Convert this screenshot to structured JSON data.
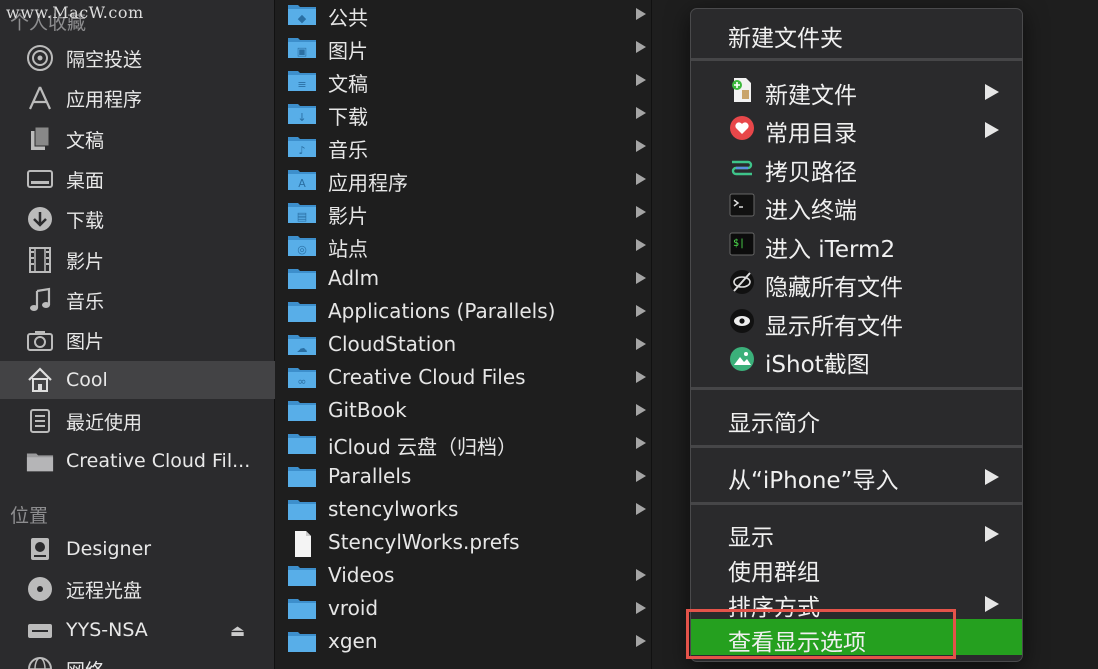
{
  "watermark": "www.MacW.com",
  "sidebar": {
    "favorites_heading": "个人收藏",
    "favorites": [
      {
        "label": "隔空投送",
        "icon": "airdrop-icon"
      },
      {
        "label": "应用程序",
        "icon": "applications-icon"
      },
      {
        "label": "文稿",
        "icon": "documents-icon"
      },
      {
        "label": "桌面",
        "icon": "desktop-icon"
      },
      {
        "label": "下载",
        "icon": "downloads-icon"
      },
      {
        "label": "影片",
        "icon": "movies-icon"
      },
      {
        "label": "音乐",
        "icon": "music-icon"
      },
      {
        "label": "图片",
        "icon": "pictures-icon"
      },
      {
        "label": "Cool",
        "icon": "home-icon",
        "selected": true
      },
      {
        "label": "最近使用",
        "icon": "recents-icon"
      },
      {
        "label": "Creative Cloud Fil...",
        "icon": "folder-icon"
      }
    ],
    "locations_heading": "位置",
    "locations": [
      {
        "label": "Designer",
        "icon": "hard-drive-icon"
      },
      {
        "label": "远程光盘",
        "icon": "optical-disc-icon"
      },
      {
        "label": "YYS-NSA",
        "icon": "network-drive-icon",
        "eject": "⏏"
      },
      {
        "label": "网络",
        "icon": "network-icon"
      }
    ]
  },
  "column": {
    "items": [
      {
        "label": "公共",
        "icon": "public-folder-icon",
        "arrow": true
      },
      {
        "label": "图片",
        "icon": "pictures-folder-icon",
        "arrow": true
      },
      {
        "label": "文稿",
        "icon": "documents-folder-icon",
        "arrow": true
      },
      {
        "label": "下载",
        "icon": "downloads-folder-icon",
        "arrow": true
      },
      {
        "label": "音乐",
        "icon": "music-folder-icon",
        "arrow": true
      },
      {
        "label": "应用程序",
        "icon": "applications-folder-icon",
        "arrow": true
      },
      {
        "label": "影片",
        "icon": "movies-folder-icon",
        "arrow": true
      },
      {
        "label": "站点",
        "icon": "sites-folder-icon",
        "arrow": true
      },
      {
        "label": "Adlm",
        "icon": "folder-icon",
        "arrow": true
      },
      {
        "label": "Applications (Parallels)",
        "icon": "folder-icon",
        "arrow": true
      },
      {
        "label": "CloudStation",
        "icon": "cloud-folder-icon",
        "arrow": true
      },
      {
        "label": "Creative Cloud Files",
        "icon": "creative-cloud-folder-icon",
        "arrow": true
      },
      {
        "label": "GitBook",
        "icon": "folder-icon",
        "arrow": true
      },
      {
        "label": "iCloud 云盘（归档）",
        "icon": "folder-icon",
        "arrow": true
      },
      {
        "label": "Parallels",
        "icon": "folder-icon",
        "arrow": true
      },
      {
        "label": "stencylworks",
        "icon": "folder-icon",
        "arrow": true
      },
      {
        "label": "StencylWorks.prefs",
        "icon": "document-icon",
        "arrow": false
      },
      {
        "label": "Videos",
        "icon": "folder-icon",
        "arrow": true
      },
      {
        "label": "vroid",
        "icon": "folder-icon",
        "arrow": true
      },
      {
        "label": "xgen",
        "icon": "folder-icon",
        "arrow": true
      }
    ]
  },
  "menu": {
    "new_folder": "新建文件夹",
    "group2": [
      {
        "label": "新建文件",
        "icon": "new-file-icon",
        "submenu": true
      },
      {
        "label": "常用目录",
        "icon": "heart-icon",
        "submenu": true
      },
      {
        "label": "拷贝路径",
        "icon": "copy-path-icon",
        "submenu": false
      },
      {
        "label": "进入终端",
        "icon": "terminal-icon",
        "submenu": false
      },
      {
        "label": "进入 iTerm2",
        "icon": "iterm-icon",
        "submenu": false
      },
      {
        "label": "隐藏所有文件",
        "icon": "eye-slash-icon",
        "submenu": false
      },
      {
        "label": "显示所有文件",
        "icon": "eye-icon",
        "submenu": false
      },
      {
        "label": "iShot截图",
        "icon": "ishot-icon",
        "submenu": false
      }
    ],
    "get_info": "显示简介",
    "import_iphone": "从“iPhone”导入",
    "show": "显示",
    "use_groups": "使用群组",
    "sort_by": "排序方式",
    "view_options": "查看显示选项"
  },
  "colors": {
    "highlight": "#25a01f",
    "annotation_box": "#e4534a",
    "folder_blue": "#4aa6e0"
  }
}
